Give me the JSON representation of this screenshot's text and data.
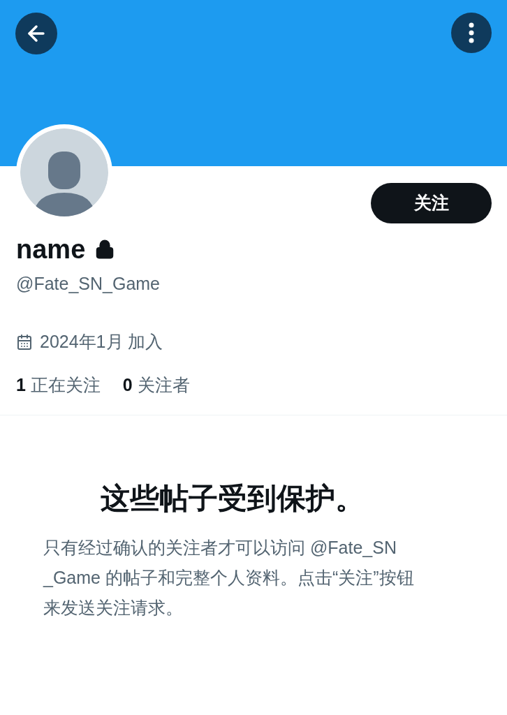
{
  "profile": {
    "name": "name",
    "protected": true,
    "handle": "@Fate_SN_Game",
    "joined": "2024年1月 加入"
  },
  "follow_button": "关注",
  "stats": [
    {
      "count": "1",
      "label": "正在关注"
    },
    {
      "count": "0",
      "label": "关注者"
    }
  ],
  "notice": {
    "title": "这些帖子受到保护。",
    "body_lines": [
      "只有经过确认的关注者才可以访问 @Fate_SN",
      "_Game 的帖子和完整个人资料。点击“关注”按钮",
      "来发送关注请求。"
    ]
  }
}
